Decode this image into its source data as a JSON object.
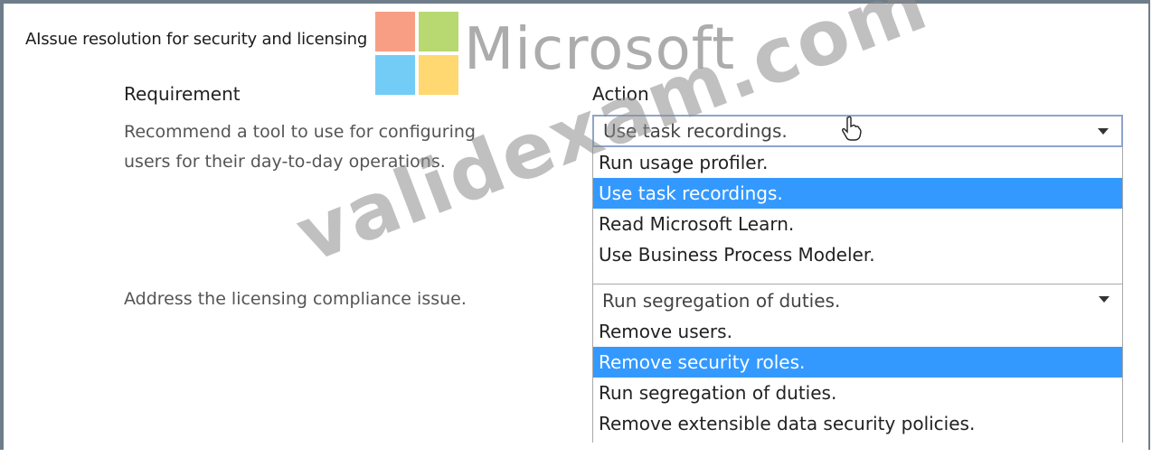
{
  "title": "AIssue resolution for security and licensing",
  "branding": {
    "logo_text": "Microsoft",
    "watermark": "validexam.com"
  },
  "headers": {
    "requirement": "Requirement",
    "action": "Action"
  },
  "rows": [
    {
      "requirement_line1": "Recommend a tool to use for configuring",
      "requirement_line2": "users for their day-to-day operations.",
      "selected": "Use task recordings.",
      "options": [
        "Run usage profiler.",
        "Use task recordings.",
        "Read Microsoft Learn.",
        "Use Business Process Modeler."
      ],
      "highlighted_index": 1
    },
    {
      "requirement_line1": "Address the licensing compliance issue.",
      "selected": "Run segregation of duties.",
      "options": [
        "Remove users.",
        "Remove security roles.",
        "Run segregation of duties.",
        "Remove extensible data security policies."
      ],
      "highlighted_index": 1
    }
  ],
  "colors": {
    "highlight": "#3399ff",
    "frame": "#6f7d8a"
  },
  "icons": [
    "microsoft-logo-icon",
    "hand-cursor-icon",
    "chevron-down-icon"
  ]
}
